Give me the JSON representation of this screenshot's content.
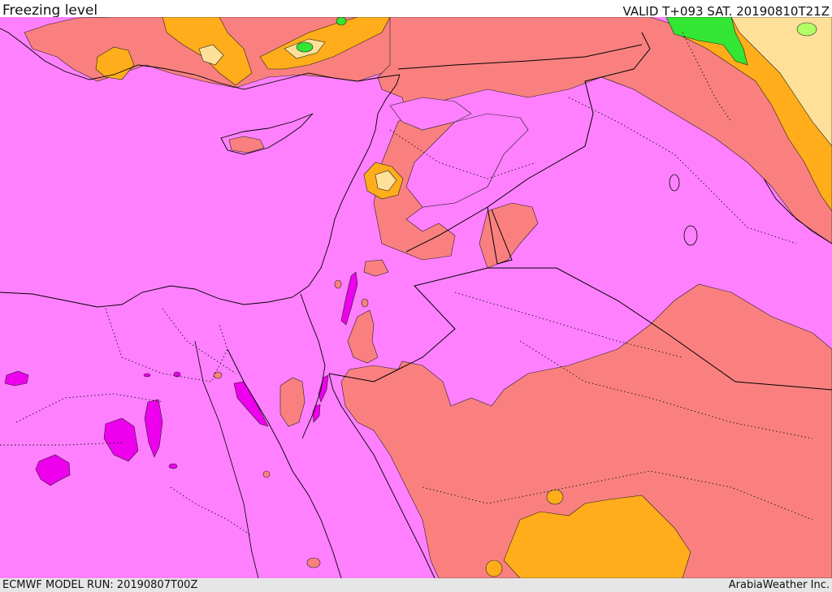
{
  "header": {
    "title": "Freezing level",
    "valid_time": "VALID T+093 SAT. 20190810T21Z"
  },
  "footer": {
    "model_run": "ECMWF MODEL RUN: 20190807T00Z",
    "credit": "ArabiaWeather Inc."
  },
  "colors": {
    "base_magenta": "#ff80ff",
    "salmon": "#fa8080",
    "orange": "#ffad1a",
    "pale_yellow": "#ffe099",
    "green": "#33e633",
    "light_green": "#b3ff66",
    "deep_magenta": "#ee00ee",
    "coastline": "#000000"
  }
}
